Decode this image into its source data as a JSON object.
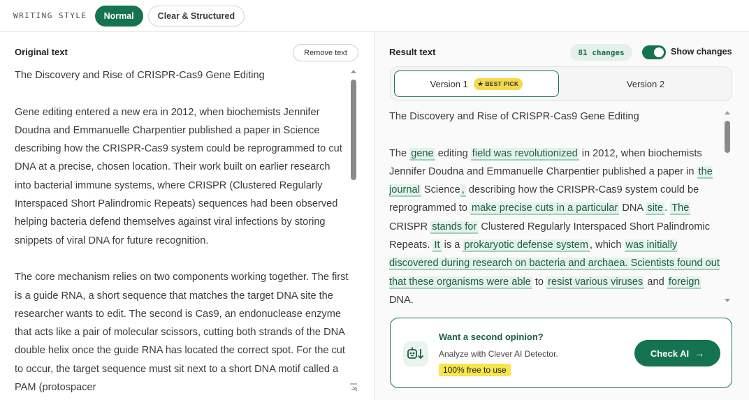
{
  "topbar": {
    "label": "WRITING STYLE",
    "styles": [
      {
        "label": "Normal",
        "active": true
      },
      {
        "label": "Clear & Structured",
        "active": false
      }
    ]
  },
  "original": {
    "title": "Original text",
    "remove_label": "Remove text",
    "paragraphs": [
      "The Discovery and Rise of CRISPR-Cas9 Gene Editing",
      "Gene editing entered a new era in 2012, when biochemists Jennifer Doudna and Emmanuelle Charpentier published a paper in Science describing how the CRISPR-Cas9 system could be reprogrammed to cut DNA at a precise, chosen location. Their work built on earlier research into bacterial immune systems, where CRISPR (Clustered Regularly Interspaced Short Palindromic Repeats) sequences had been observed helping bacteria defend themselves against viral infections by storing snippets of viral DNA for future recognition.",
      "The core mechanism relies on two components working together. The first is a guide RNA, a short sequence that matches the target DNA site the researcher wants to edit. The second is Cas9, an endonuclease enzyme that acts like a pair of molecular scissors, cutting both strands of the DNA double helix once the guide RNA has located the correct spot. For the cut to occur, the target sequence must sit next to a short DNA motif called a PAM (protospacer"
    ]
  },
  "result": {
    "title": "Result text",
    "changes_badge": "81 changes",
    "show_changes_label": "Show changes",
    "versions": [
      {
        "label": "Version 1",
        "badge": "★ BEST PICK",
        "active": true
      },
      {
        "label": "Version 2",
        "active": false
      }
    ],
    "heading": "The Discovery and Rise of CRISPR-Cas9 Gene Editing",
    "segments": [
      {
        "t": "The ",
        "c": false
      },
      {
        "t": "gene",
        "c": true
      },
      {
        "t": " editing ",
        "c": false
      },
      {
        "t": "field was revolutionized",
        "c": true
      },
      {
        "t": " in 2012, when biochemists Jennifer Doudna and Emmanuelle Charpentier published a paper in ",
        "c": false
      },
      {
        "t": "the journal",
        "c": true
      },
      {
        "t": " Science",
        "c": false
      },
      {
        "t": ",",
        "c": true
      },
      {
        "t": " describing how the CRISPR-Cas9 system could be reprogrammed to ",
        "c": false
      },
      {
        "t": "make precise cuts in a particular",
        "c": true
      },
      {
        "t": " DNA ",
        "c": false
      },
      {
        "t": "site",
        "c": true
      },
      {
        "t": ". ",
        "c": false
      },
      {
        "t": "The",
        "c": true
      },
      {
        "t": " CRISPR ",
        "c": false
      },
      {
        "t": "stands for",
        "c": true
      },
      {
        "t": " Clustered Regularly Interspaced Short Palindromic Repeats. ",
        "c": false
      },
      {
        "t": "It",
        "c": true
      },
      {
        "t": " is a ",
        "c": false
      },
      {
        "t": "prokaryotic defense system",
        "c": true
      },
      {
        "t": ", which ",
        "c": false
      },
      {
        "t": "was initially discovered during research on bacteria and archaea. Scientists found out that these organisms were able",
        "c": true
      },
      {
        "t": " to ",
        "c": false
      },
      {
        "t": "resist various viruses",
        "c": true
      },
      {
        "t": " and ",
        "c": false
      },
      {
        "t": "foreign",
        "c": true
      },
      {
        "t": " DNA.",
        "c": false
      }
    ]
  },
  "promo": {
    "title": "Want a second opinion?",
    "subtitle": "Analyze with Clever AI Detector.",
    "free_label": "100% free to use",
    "button_label": "Check AI",
    "icon": "robot-download-icon"
  },
  "colors": {
    "accent": "#15744f",
    "change_bg": "#e4f2eb",
    "badge_yellow": "#f5d94c"
  }
}
